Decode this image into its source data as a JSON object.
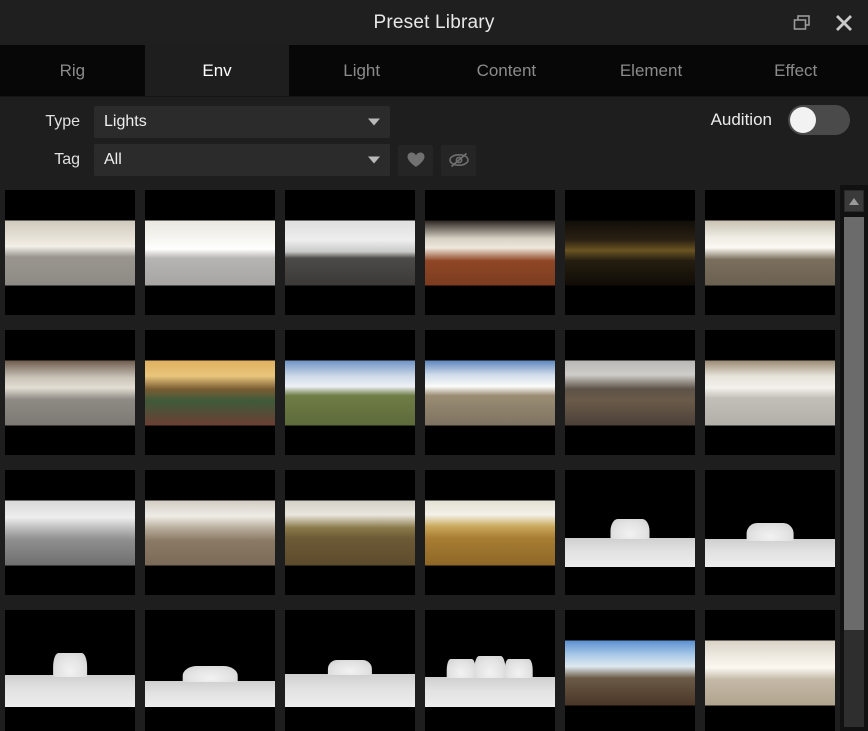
{
  "window": {
    "title": "Preset Library",
    "buttons": [
      {
        "name": "restore-window-button",
        "icon": "restore-icon"
      },
      {
        "name": "close-window-button",
        "icon": "close-icon"
      }
    ]
  },
  "tabs": [
    {
      "label": "Rig",
      "active": false
    },
    {
      "label": "Env",
      "active": true
    },
    {
      "label": "Light",
      "active": false
    },
    {
      "label": "Content",
      "active": false
    },
    {
      "label": "Element",
      "active": false
    },
    {
      "label": "Effect",
      "active": false
    }
  ],
  "filters": {
    "type": {
      "label": "Type",
      "value": "Lights"
    },
    "tag": {
      "label": "Tag",
      "value": "All"
    },
    "favorite_button": "heart-icon",
    "hidden_button": "eye-slash-icon"
  },
  "audition": {
    "label": "Audition",
    "enabled": false
  },
  "colors": {
    "window_bg": "#1e1e1e",
    "titlebar_bg": "#1f1f1f",
    "tabbar_bg": "#070707",
    "tab_active_bg": "#1e1e1e",
    "tab_active_text": "#ffffff",
    "tab_inactive_text": "#8b8b8b",
    "field_bg": "#2b2b2b",
    "text": "#e8e8e8",
    "tile_bg": "#000000",
    "scrollbar_thumb": "#6b6b6b",
    "toggle_track": "#4a4a4a",
    "toggle_knob": "#f2f2f2"
  },
  "grid": {
    "columns": 6,
    "rows": 4,
    "tiles": [
      {
        "id": 1,
        "kind": "panorama",
        "scene": "white-interior-showroom"
      },
      {
        "id": 2,
        "kind": "panorama",
        "scene": "bright-warehouse-interior"
      },
      {
        "id": 3,
        "kind": "panorama",
        "scene": "overcast-parking-lot"
      },
      {
        "id": 4,
        "kind": "panorama",
        "scene": "red-floor-lobby"
      },
      {
        "id": 5,
        "kind": "panorama",
        "scene": "dark-industrial-hall"
      },
      {
        "id": 6,
        "kind": "panorama",
        "scene": "outdoor-bright-plaza"
      },
      {
        "id": 7,
        "kind": "panorama",
        "scene": "grey-industrial-yard"
      },
      {
        "id": 8,
        "kind": "panorama",
        "scene": "warm-living-room"
      },
      {
        "id": 9,
        "kind": "panorama",
        "scene": "green-field-blue-sky"
      },
      {
        "id": 10,
        "kind": "panorama",
        "scene": "desert-plain-clouds"
      },
      {
        "id": 11,
        "kind": "panorama",
        "scene": "workshop-interior"
      },
      {
        "id": 12,
        "kind": "panorama",
        "scene": "covered-market-hall"
      },
      {
        "id": 13,
        "kind": "panorama",
        "scene": "car-park-structure"
      },
      {
        "id": 14,
        "kind": "panorama",
        "scene": "bare-winter-forest"
      },
      {
        "id": 15,
        "kind": "panorama",
        "scene": "autumn-forest-path"
      },
      {
        "id": 16,
        "kind": "panorama",
        "scene": "autumn-leaf-field"
      },
      {
        "id": 17,
        "kind": "studio",
        "scene": "softbox-single-dome"
      },
      {
        "id": 18,
        "kind": "studio",
        "scene": "softbox-wide-dome"
      },
      {
        "id": 19,
        "kind": "studio",
        "scene": "softbox-tall-dome"
      },
      {
        "id": 20,
        "kind": "studio",
        "scene": "softbox-broad-dome"
      },
      {
        "id": 21,
        "kind": "studio",
        "scene": "softbox-low-strip"
      },
      {
        "id": 22,
        "kind": "studio",
        "scene": "softbox-triple-dome"
      },
      {
        "id": 23,
        "kind": "panorama",
        "scene": "house-blue-sky-yard"
      },
      {
        "id": 24,
        "kind": "panorama",
        "scene": "bright-bedroom-interior"
      }
    ]
  },
  "scrollbar": {
    "up_arrow": "triangle-up-icon",
    "thumb_position": "top"
  }
}
